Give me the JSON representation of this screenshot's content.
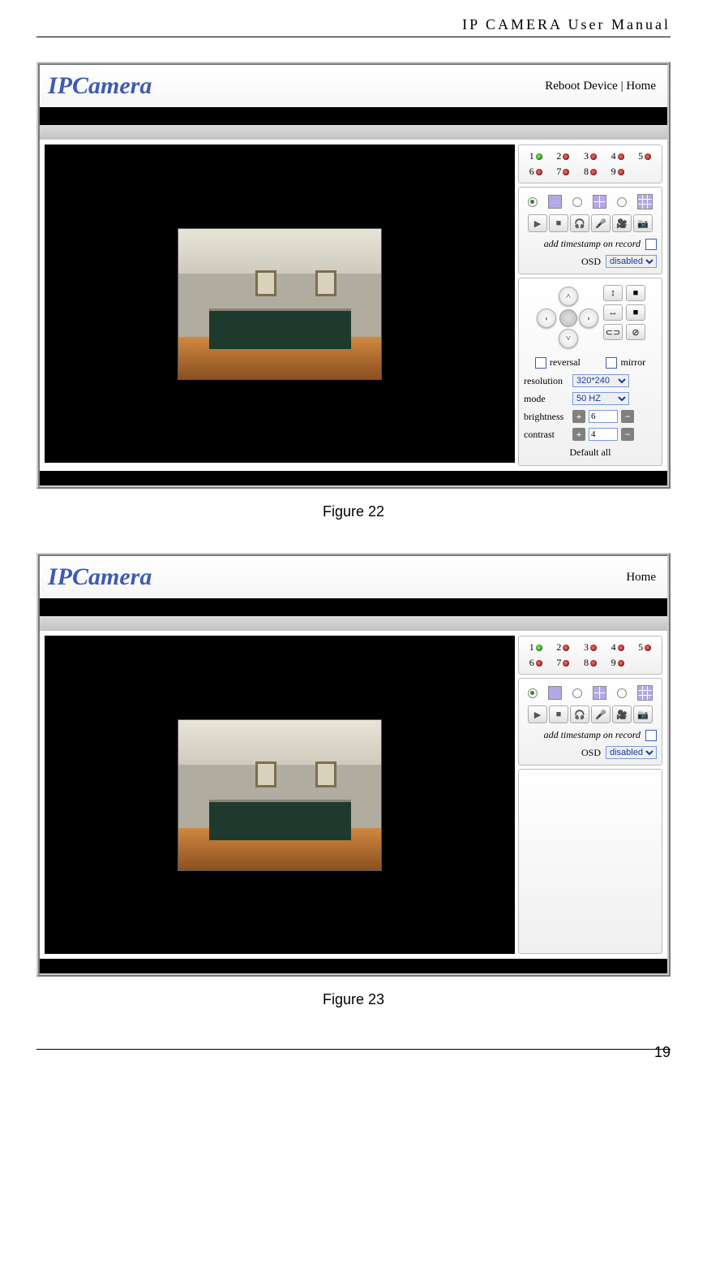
{
  "header_text": "IP CAMERA User Manual",
  "page_number": "19",
  "figures": {
    "fig22_caption": "Figure 22",
    "fig23_caption": "Figure 23"
  },
  "app": {
    "logo": "IPCamera",
    "links": {
      "reboot": "Reboot Device",
      "sep": " | ",
      "home": "Home"
    },
    "channels": {
      "c1": "1",
      "c2": "2",
      "c3": "3",
      "c4": "4",
      "c5": "5",
      "c6": "6",
      "c7": "7",
      "c8": "8",
      "c9": "9"
    },
    "timestamp_label": "add timestamp on record",
    "osd_label": "OSD",
    "osd_value": "disabled",
    "reversal_label": "reversal",
    "mirror_label": "mirror",
    "resolution_label": "resolution",
    "resolution_value": "320*240",
    "mode_label": "mode",
    "mode_value": "50 HZ",
    "brightness_label": "brightness",
    "brightness_value": "6",
    "contrast_label": "contrast",
    "contrast_value": "4",
    "default_all": "Default all",
    "plus": "+",
    "minus": "−"
  }
}
